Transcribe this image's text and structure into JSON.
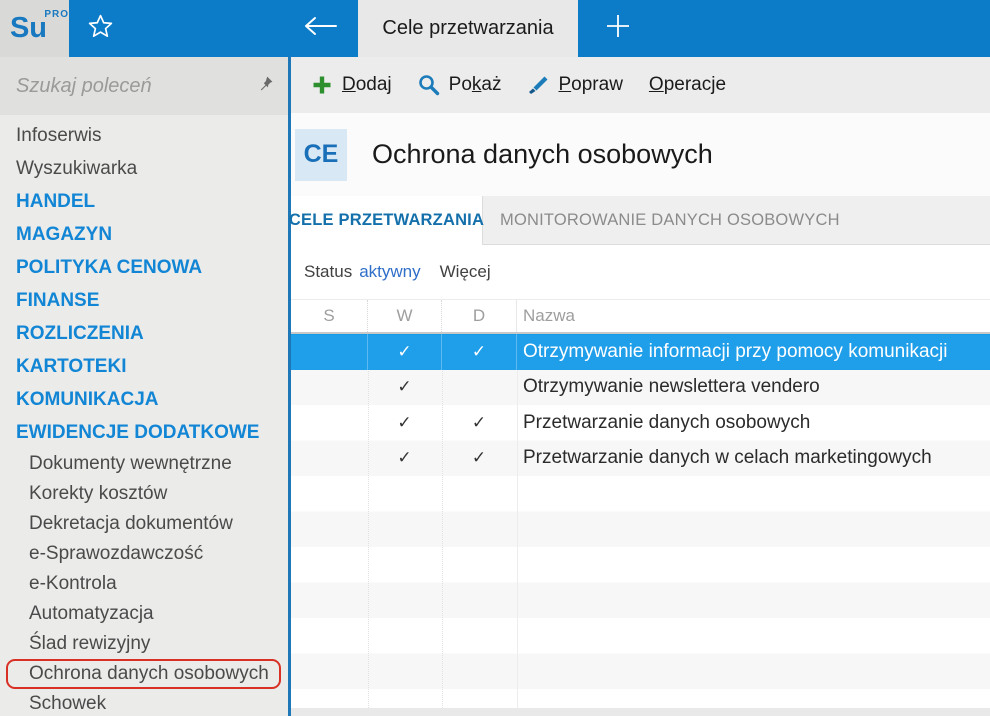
{
  "topbar": {
    "logo_text": "Su",
    "logo_badge": "PRO",
    "active_tab_label": "Cele przetwarzania",
    "icons": {
      "star": "favorites-star-icon",
      "back": "back-arrow-icon",
      "plus": "new-tab-plus-icon"
    }
  },
  "sidebar": {
    "search": {
      "placeholder": "Szukaj poleceń",
      "pin_icon": "pin-icon"
    },
    "items": [
      {
        "label": "Infoserwis",
        "type": "item"
      },
      {
        "label": "Wyszukiwarka",
        "type": "item"
      },
      {
        "label": "HANDEL",
        "type": "category"
      },
      {
        "label": "MAGAZYN",
        "type": "category"
      },
      {
        "label": "POLITYKA CENOWA",
        "type": "category"
      },
      {
        "label": "FINANSE",
        "type": "category"
      },
      {
        "label": "ROZLICZENIA",
        "type": "category"
      },
      {
        "label": "KARTOTEKI",
        "type": "category"
      },
      {
        "label": "KOMUNIKACJA",
        "type": "category"
      },
      {
        "label": "EWIDENCJE DODATKOWE",
        "type": "category"
      },
      {
        "label": "Dokumenty wewnętrzne",
        "type": "subitem"
      },
      {
        "label": "Korekty kosztów",
        "type": "subitem"
      },
      {
        "label": "Dekretacja dokumentów",
        "type": "subitem"
      },
      {
        "label": "e-Sprawozdawczość",
        "type": "subitem"
      },
      {
        "label": "e-Kontrola",
        "type": "subitem"
      },
      {
        "label": "Automatyzacja",
        "type": "subitem"
      },
      {
        "label": "Ślad rewizyjny",
        "type": "subitem"
      },
      {
        "label": "Ochrona danych osobowych",
        "type": "subitem",
        "highlighted": true
      },
      {
        "label": "Schowek",
        "type": "subitem"
      }
    ]
  },
  "toolbar": {
    "buttons": [
      {
        "name": "add",
        "icon": "plus-icon",
        "prefix": "",
        "accel": "D",
        "suffix": "odaj"
      },
      {
        "name": "show",
        "icon": "magnifier-icon",
        "prefix": "Po",
        "accel": "k",
        "suffix": "aż"
      },
      {
        "name": "edit",
        "icon": "brush-icon",
        "prefix": "",
        "accel": "P",
        "suffix": "opraw"
      },
      {
        "name": "operations",
        "icon": "",
        "prefix": "",
        "accel": "O",
        "suffix": "peracje"
      }
    ]
  },
  "content": {
    "module_badge": "CE",
    "title": "Ochrona danych osobowych",
    "tabs": [
      {
        "label": "CELE PRZETWARZANIA",
        "active": true
      },
      {
        "label": "MONITOROWANIE DANYCH OSOBOWYCH",
        "active": false
      }
    ],
    "filter": {
      "status_label": "Status",
      "status_value": "aktywny",
      "more_label": "Więcej"
    },
    "table": {
      "columns": [
        "S",
        "W",
        "D",
        "Nazwa"
      ],
      "check_glyph": "✓",
      "rows": [
        {
          "selected": true,
          "s": false,
          "w": true,
          "d": true,
          "name": "Otrzymywanie informacji przy pomocy komunikacji"
        },
        {
          "selected": false,
          "s": false,
          "w": true,
          "d": false,
          "name": "Otrzymywanie newslettera vendero"
        },
        {
          "selected": false,
          "s": false,
          "w": true,
          "d": true,
          "name": "Przetwarzanie danych osobowych"
        },
        {
          "selected": false,
          "s": false,
          "w": true,
          "d": true,
          "name": "Przetwarzanie danych w celach marketingowych"
        }
      ]
    }
  },
  "colors": {
    "topbar_blue": "#0c7bc8",
    "selected_row_blue": "#1f9ee9",
    "category_blue": "#1286d5",
    "active_tab_blue": "#1470ab",
    "link_blue": "#2f6fc8",
    "badge_bg": "#d9e8f5",
    "badge_text": "#1a70b8",
    "highlight_red": "#d93026",
    "stripe_gray": "#f7f7f7"
  }
}
